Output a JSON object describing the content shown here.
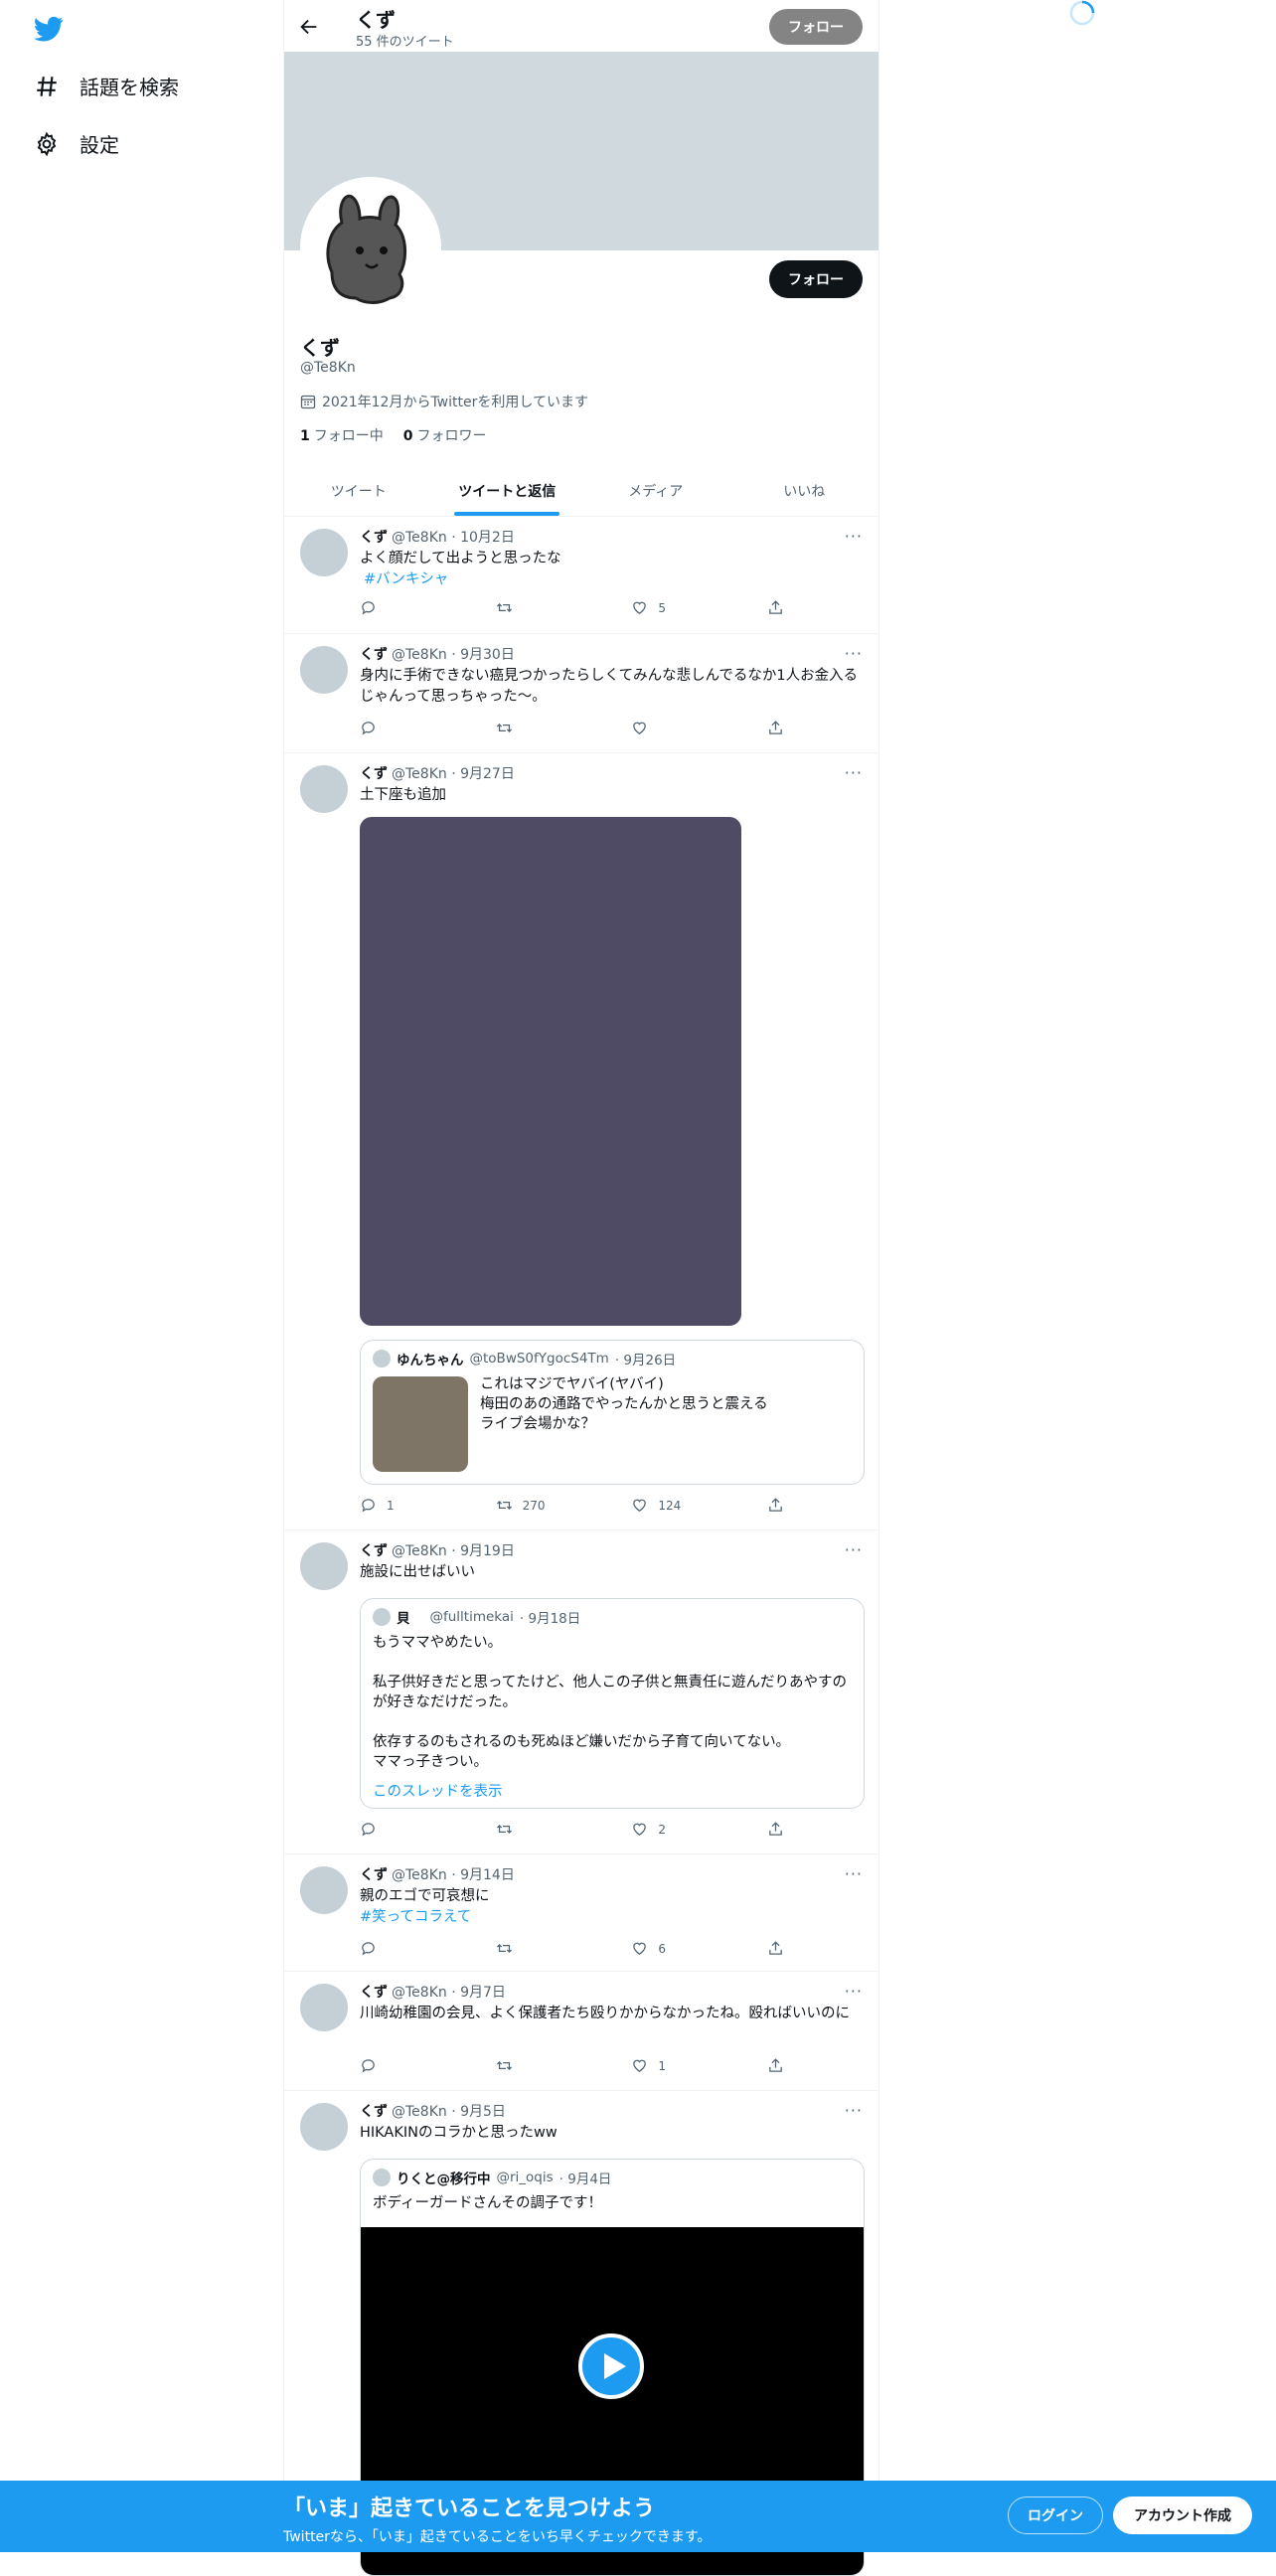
{
  "sidebar": {
    "items": [
      {
        "label": "話題を検索"
      },
      {
        "label": "設定"
      }
    ]
  },
  "header": {
    "name": "くず",
    "tweet_count": "55 件のツイート",
    "follow_label": "フォロー"
  },
  "profile": {
    "name": "くず",
    "handle": "@Te8Kn",
    "joined": "2021年12月からTwitterを利用しています",
    "following_count": "1",
    "following_label": "フォロー中",
    "followers_count": "0",
    "followers_label": "フォロワー",
    "follow_label": "フォロー"
  },
  "tabs": [
    {
      "label": "ツイート"
    },
    {
      "label": "ツイートと返信"
    },
    {
      "label": "メディア"
    },
    {
      "label": "いいね"
    }
  ],
  "tweets": [
    {
      "name": "くず",
      "handle": "@Te8Kn",
      "date": "· 10月2日",
      "text": "よく顔だして出ようと思ったな",
      "tag": "#バンキシャ",
      "reply": "",
      "retweet": "",
      "like": "5"
    },
    {
      "name": "くず",
      "handle": "@Te8Kn",
      "date": "· 9月30日",
      "text": "身内に手術できない癌見つかったらしくてみんな悲しんでるなか1人お金入るじゃんって思っちゃった〜。",
      "reply": "",
      "retweet": "",
      "like": ""
    },
    {
      "name": "くず",
      "handle": "@Te8Kn",
      "date": "· 9月27日",
      "text": "土下座も追加",
      "quote": {
        "name": "ゆんちゃん",
        "handle": "@toBwS0fYgocS4Tm",
        "date": "· 9月26日",
        "text": "これはマジでヤバイ(ヤバイ)\n梅田のあの通路でやったんかと思うと震える\nライブ会場かな？"
      },
      "reply": "1",
      "retweet": "270",
      "like": "124"
    },
    {
      "name": "くず",
      "handle": "@Te8Kn",
      "date": "· 9月19日",
      "text": "施設に出せばいい",
      "quote": {
        "name": "貝",
        "handle": "@fulltimekai",
        "date": "· 9月18日",
        "text": "もうママやめたい。\n\n私子供好きだと思ってたけど、他人この子供と無責任に遊んだりあやすのが好きなだけだった。\n\n依存するのもされるのも死ぬほど嫌いだから子育て向いてない。\nママっ子きつい。",
        "link": "このスレッドを表示"
      },
      "reply": "",
      "retweet": "",
      "like": "2"
    },
    {
      "name": "くず",
      "handle": "@Te8Kn",
      "date": "· 9月14日",
      "text": "親のエゴで可哀想に",
      "tag": "#笑ってコラえて",
      "reply": "",
      "retweet": "",
      "like": "6"
    },
    {
      "name": "くず",
      "handle": "@Te8Kn",
      "date": "· 9月7日",
      "text": "川崎幼稚園の会見、よく保護者たち殴りかからなかったね。殴ればいいのに",
      "reply": "",
      "retweet": "",
      "like": "1"
    },
    {
      "name": "くず",
      "handle": "@Te8Kn",
      "date": "· 9月5日",
      "text": "HIKAKINのコラかと思ったww",
      "quote": {
        "name": "りくと@移行中",
        "handle": "@ri_oqis",
        "date": "· 9月4日",
        "text": "ボディーガードさんその調子です！"
      }
    }
  ],
  "bottom_bar": {
    "title": "「いま」起きていることを見つけよう",
    "subtitle": "Twitterなら、「いま」起きていることをいち早くチェックできます。",
    "login_label": "ログイン",
    "signup_label": "アカウント作成"
  },
  "colors": {
    "accent": "#1d9bf0",
    "banner": "#cfd9de",
    "text": "#0f1419",
    "muted": "#536471"
  },
  "icons": [
    "twitter-logo-icon",
    "hashtag-icon",
    "gear-icon",
    "back-arrow-icon",
    "calendar-icon",
    "reply-icon",
    "retweet-icon",
    "like-icon",
    "share-icon",
    "play-icon",
    "spinner-icon"
  ]
}
